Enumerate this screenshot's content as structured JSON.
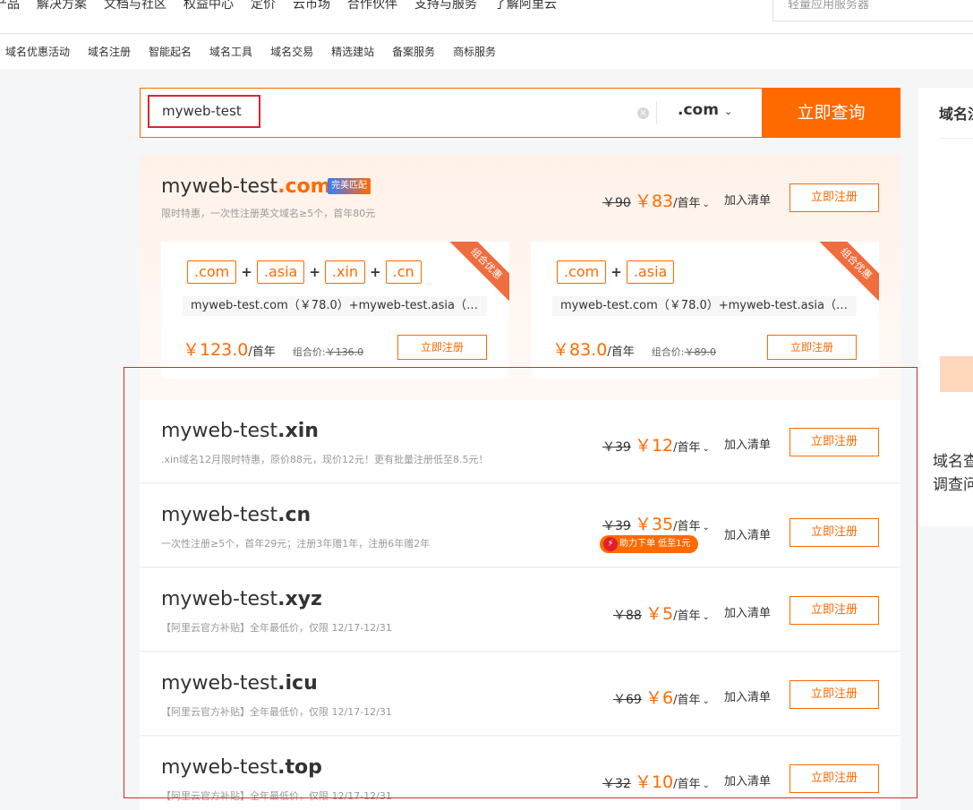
{
  "topnav": {
    "items": [
      "产品",
      "解决方案",
      "文档与社区",
      "权益中心",
      "定价",
      "云市场",
      "合作伙伴",
      "支持与服务",
      "了解阿里云"
    ],
    "search_placeholder": "轻量应用服务器"
  },
  "subnav": {
    "items": [
      "域名优惠活动",
      "域名注册",
      "智能起名",
      "域名工具",
      "域名交易",
      "精选建站",
      "备案服务",
      "商标服务"
    ]
  },
  "search": {
    "query": "myweb-test",
    "suffix": ".com",
    "submit_label": "立即查询"
  },
  "right_panel": {
    "title": "域名注",
    "text_line1": "域名查",
    "text_line2": "调查问"
  },
  "common": {
    "add_to_list": "加入清单",
    "register": "立即注册",
    "per_year": "/首年"
  },
  "featured": {
    "name": "myweb-test",
    "tld": ".com",
    "badge": "完美匹配",
    "desc": "限时特惠，一次性注册英文域名≥5个，首年80元",
    "old_price": "￥90",
    "new_price": "￥83",
    "combos": [
      {
        "ribbon": "组合优惠",
        "tags": [
          ".com",
          ".asia",
          ".xin",
          ".cn"
        ],
        "domains_text": "myweb-test.com（￥78.0）+myweb-test.asia（…",
        "price": "￥123.0",
        "combo_label": "组合价:",
        "combo_old": "￥136.0"
      },
      {
        "ribbon": "组合优惠",
        "tags": [
          ".com",
          ".asia"
        ],
        "domains_text": "myweb-test.com（￥78.0）+myweb-test.asia（…",
        "price": "￥83.0",
        "combo_label": "组合价:",
        "combo_old": "￥89.0"
      }
    ]
  },
  "rows": [
    {
      "name": "myweb-test",
      "tld": ".xin",
      "desc": ".xin域名12月限时特惠，原价88元，现价12元！更有批量注册低至8.5元！",
      "old_price": "￥39",
      "new_price": "￥12"
    },
    {
      "name": "myweb-test",
      "tld": ".cn",
      "desc": "一次性注册≥5个，首年29元；注册3年赠1年，注册6年赠2年",
      "old_price": "￥39",
      "new_price": "￥35",
      "promo": "助力下单 低至1元"
    },
    {
      "name": "myweb-test",
      "tld": ".xyz",
      "desc": "【阿里云官方补贴】全年最低价，仅限 12/17-12/31",
      "old_price": "￥88",
      "new_price": "￥5"
    },
    {
      "name": "myweb-test",
      "tld": ".icu",
      "desc": "【阿里云官方补贴】全年最低价，仅限 12/17-12/31",
      "old_price": "￥69",
      "new_price": "￥6"
    },
    {
      "name": "myweb-test",
      "tld": ".top",
      "desc": "【阿里云官方补贴】全年最低价，仅限 12/17-12/31",
      "old_price": "￥32",
      "new_price": "￥10"
    }
  ],
  "colors": {
    "accent": "#ff6a00",
    "highlight_box": "#d9282f"
  }
}
